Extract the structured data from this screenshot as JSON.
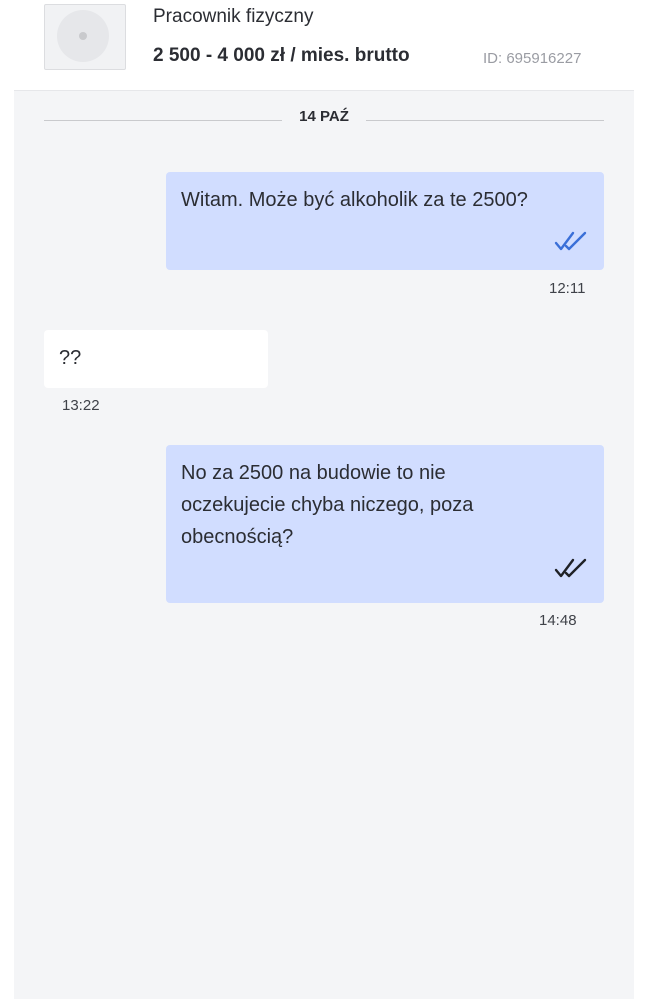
{
  "listing": {
    "thumbnail_icon": "placeholder-disc-icon",
    "title": "Pracownik fizyczny",
    "salary": "2 500 - 4 000 zł / mies. brutto",
    "id_label": "ID: 695916227"
  },
  "conversation": {
    "date_separator": "14 PAŹ",
    "messages": [
      {
        "direction": "outgoing",
        "text": "Witam. Może być alkoholik za te 2500?",
        "time": "12:11",
        "status_icon": "double-check-icon"
      },
      {
        "direction": "incoming",
        "text": "??",
        "time": "13:22"
      },
      {
        "direction": "outgoing",
        "lines": [
          "No za 2500 na budowie to nie",
          "oczekujecie chyba niczego, poza",
          "obecnością?"
        ],
        "time": "14:48",
        "status_icon": "double-check-icon"
      }
    ]
  },
  "colors": {
    "outgoing_bubble": "#d1ddff",
    "incoming_bubble": "#ffffff",
    "background": "#f4f5f7",
    "tick_blue": "#3a6fd8",
    "tick_dark": "#1f2126"
  }
}
